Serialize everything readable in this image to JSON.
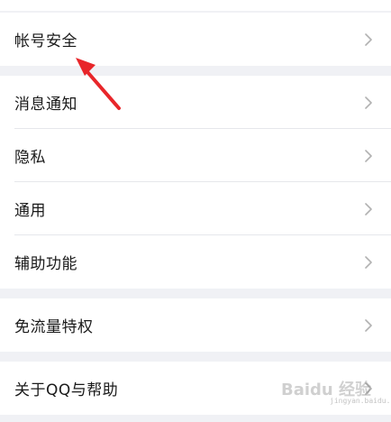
{
  "groups": [
    {
      "items": [
        {
          "label": "帐号安全"
        }
      ]
    },
    {
      "items": [
        {
          "label": "消息通知"
        },
        {
          "label": "隐私"
        },
        {
          "label": "通用"
        },
        {
          "label": "辅助功能"
        }
      ]
    },
    {
      "items": [
        {
          "label": "免流量特权"
        }
      ]
    },
    {
      "items": [
        {
          "label": "关于QQ与帮助"
        }
      ]
    }
  ],
  "annotation": {
    "arrow_color": "#e8262a"
  },
  "watermark": {
    "text": "Baidu 经验",
    "sub": "jingyan.baidu.com"
  },
  "colors": {
    "background": "#f0f1f5",
    "card": "#ffffff",
    "chevron": "#b2b2b2"
  }
}
